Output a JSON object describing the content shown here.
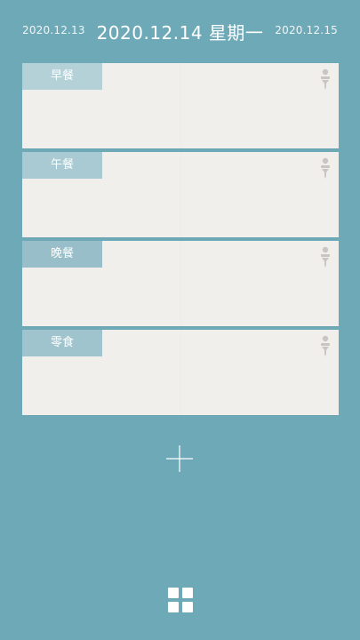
{
  "header": {
    "prev_date": "2020.12.13",
    "current_date": "2020.12.14 星期一",
    "next_date": "2020.12.15"
  },
  "meals": [
    {
      "label": "早餐",
      "tag_color": "#b5d1d8"
    },
    {
      "label": "午餐",
      "tag_color": "#a9cad3"
    },
    {
      "label": "晚餐",
      "tag_color": "#98bfc9"
    },
    {
      "label": "零食",
      "tag_color": "#a0c4cd"
    }
  ],
  "icons": {
    "pin": "pushpin-icon",
    "add": "plus-icon",
    "menu": "grid-icon"
  },
  "colors": {
    "background": "#6ea9b8",
    "card": "#f1efec",
    "pin": "#c9c6c2"
  }
}
